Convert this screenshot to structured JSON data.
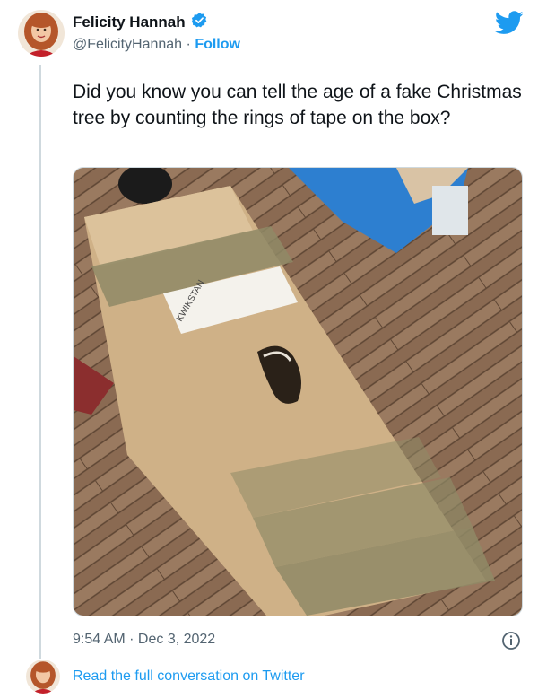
{
  "author": {
    "name": "Felicity Hannah",
    "handle": "@FelicityHannah",
    "separator": "·",
    "follow_label": "Follow",
    "verified_icon": "verified-badge-icon"
  },
  "tweet": {
    "text": "Did you know you can tell the age of a fake Christmas tree by counting the rings of tape on the box?",
    "timestamp": "9:54 AM · Dec 3, 2022"
  },
  "media": {
    "image_label": "KWIKSTAN"
  },
  "footer": {
    "read_label": "Read the full conversation on Twitter"
  },
  "colors": {
    "accent": "#1d9bf0",
    "secondary_text": "#536471",
    "thread_line": "#cfd9de"
  },
  "icons": {
    "brand": "twitter-bird-icon",
    "info": "info-icon"
  }
}
